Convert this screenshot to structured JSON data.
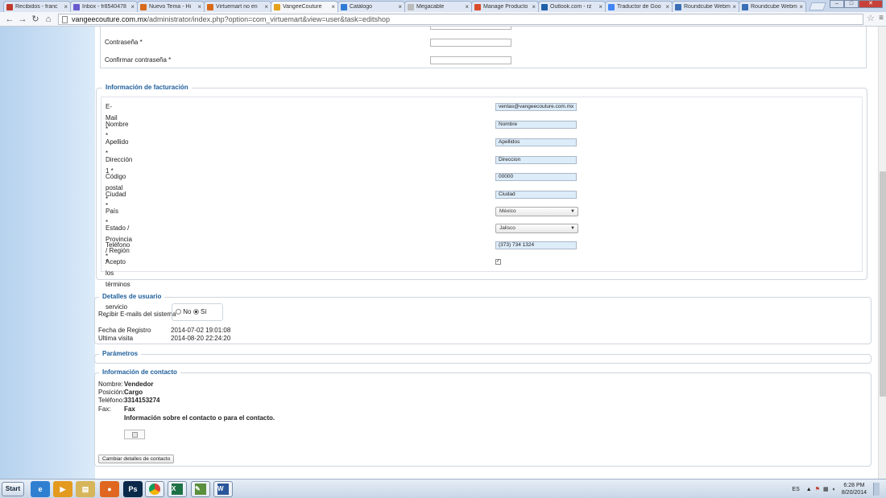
{
  "browser": {
    "tabs": [
      {
        "title": "Recibidos - franc",
        "color": "#c0392b",
        "active": false
      },
      {
        "title": "Inbox - fr8540478",
        "color": "#6a5acd",
        "active": false
      },
      {
        "title": "Nuevo Tema - Hi",
        "color": "#d86a1a",
        "active": false
      },
      {
        "title": "Virtuemart no en",
        "color": "#d86a1a",
        "active": false
      },
      {
        "title": "VangeeCouture",
        "color": "#e5a11a",
        "active": true
      },
      {
        "title": "Catálogo",
        "color": "#2e7bd6",
        "active": false
      },
      {
        "title": "Megacable",
        "color": "#bbbbbb",
        "active": false
      },
      {
        "title": "Manage Producto",
        "color": "#d94c2c",
        "active": false
      },
      {
        "title": "Outlook.com - rz",
        "color": "#1f5fa8",
        "active": false
      },
      {
        "title": "Traductor de Goo",
        "color": "#4285f4",
        "active": false
      },
      {
        "title": "Roundcube Webm",
        "color": "#3a6fb5",
        "active": false
      },
      {
        "title": "Roundcube Webm",
        "color": "#3a6fb5",
        "active": false
      }
    ],
    "tab_close": "×",
    "url_host": "vangeecouture.com.mx",
    "url_path": "/administrator/index.php?option=com_virtuemart&view=user&task=editshop"
  },
  "account": {
    "password_label": "Contraseña *",
    "confirm_password_label": "Confirmar contraseña *"
  },
  "billing": {
    "legend": "Información de facturación",
    "fields": {
      "email": {
        "label": "E-Mail *",
        "value": "ventas@vangeecouture.com.mx"
      },
      "nombre": {
        "label": "Nombre *",
        "value": "Nombre"
      },
      "apellido": {
        "label": "Apellido *",
        "value": "Apellidos"
      },
      "direccion": {
        "label": "Dirección 1 *",
        "value": "Direccion"
      },
      "cp": {
        "label": "Código postal *",
        "value": "00000"
      },
      "ciudad": {
        "label": "Ciudad *",
        "value": "Ciudad"
      },
      "pais": {
        "label": "País *",
        "value": "México"
      },
      "estado": {
        "label": "Estado / Provincia / Región *",
        "value": "Jalisco"
      },
      "telefono": {
        "label": "Teléfono *",
        "value": "(373) 734 1324"
      },
      "terminos": {
        "label": "Acepto los términos de servicio *",
        "checked": true
      }
    }
  },
  "user_details": {
    "legend": "Detalles de usuario",
    "emails_label": "Recibir E-mails del sistema",
    "option_no": "No",
    "option_si": "Sí",
    "registro_label": "Fecha de Registro",
    "registro_value": "2014-07-02 19:01:08",
    "visita_label": "Ultima visita",
    "visita_value": "2014-08-20 22:24:20"
  },
  "parametros": {
    "legend": "Parámetros"
  },
  "contact": {
    "legend": "Información de contacto",
    "nombre_label": "Nombre:",
    "nombre_value": "Vendedor",
    "posicion_label": "Posición:",
    "posicion_value": "Cargo",
    "telefono_label": "Teléfono:",
    "telefono_value": "3314153274",
    "fax_label": "Fax:",
    "fax_value": "Fax",
    "info": "Información sobre el contacto o para el contacto.",
    "button": "Cambiar detalles de contacto"
  },
  "taskbar": {
    "start": "Start",
    "lang": "ES",
    "time": "6:28 PM",
    "date": "8/20/2014"
  }
}
